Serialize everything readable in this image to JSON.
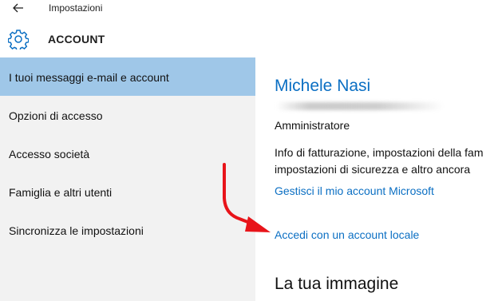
{
  "window": {
    "title": "Impostazioni"
  },
  "header": {
    "title": "ACCOUNT",
    "icon": "gear-icon"
  },
  "sidebar": {
    "items": [
      {
        "label": "I tuoi messaggi e-mail e account",
        "selected": true
      },
      {
        "label": "Opzioni di accesso",
        "selected": false
      },
      {
        "label": "Accesso società",
        "selected": false
      },
      {
        "label": "Famiglia e altri utenti",
        "selected": false
      },
      {
        "label": "Sincronizza le impostazioni",
        "selected": false
      }
    ]
  },
  "account": {
    "name": "Michele Nasi",
    "role": "Amministratore",
    "info_line1": "Info di fatturazione, impostazioni della fam",
    "info_line2": "impostazioni di sicurezza e altro ancora",
    "manage_link": "Gestisci il mio account Microsoft",
    "local_link": "Accedi con un account locale"
  },
  "picture_section": {
    "heading": "La tua immagine"
  },
  "colors": {
    "accent": "#0b6fc3",
    "selected_item": "#9fc7e8",
    "sidebar_bg": "#f2f2f2",
    "annotation_arrow": "#e8141a"
  }
}
